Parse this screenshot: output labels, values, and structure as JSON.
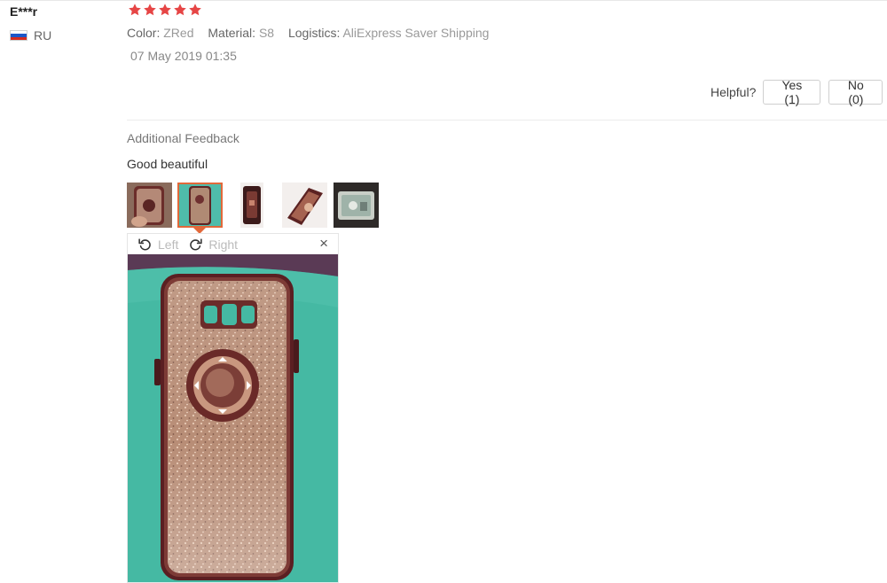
{
  "review": {
    "user": "E***r",
    "country": "RU",
    "rating": 5,
    "star_color": "#e64545",
    "color_label": "Color:",
    "color_value": "ZRed",
    "material_label": "Material:",
    "material_value": "S8",
    "logistics_label": "Logistics:",
    "logistics_value": "AliExpress Saver Shipping",
    "date": "07 May 2019 01:35",
    "helpful_label": "Helpful?",
    "yes_label": "Yes (1)",
    "no_label": "No (0)"
  },
  "feedback": {
    "title": "Additional Feedback",
    "text": "Good beautiful",
    "selected_thumb": 2
  },
  "viewer": {
    "rotate_left_label": "Left",
    "rotate_right_label": "Right",
    "close_glyph": "×"
  },
  "colors": {
    "accent": "#e2683a",
    "phone_case": "#6e2b2b",
    "cloth": "#3fb6a0"
  }
}
